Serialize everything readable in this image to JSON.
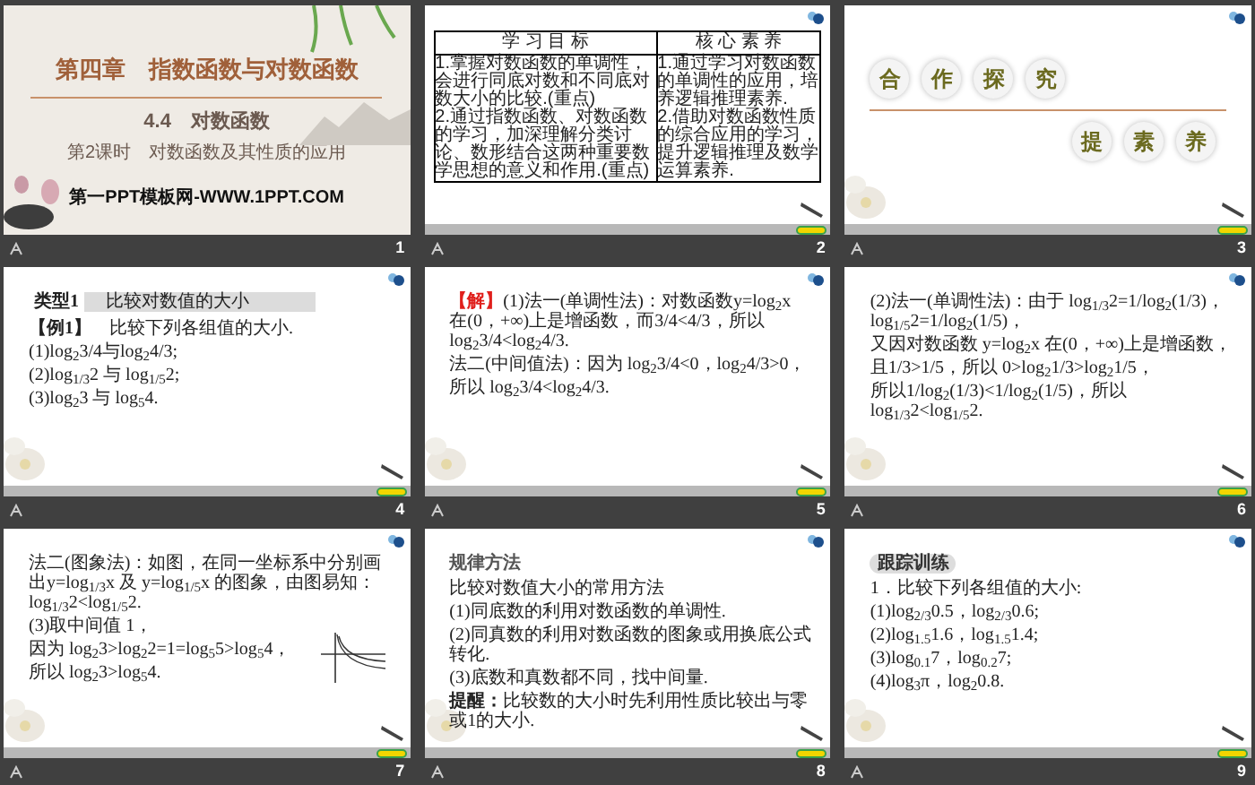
{
  "slides": [
    {
      "kind": "title",
      "number": "1",
      "chapter": "第四章　指数函数与对数函数",
      "section": "4.4　对数函数",
      "lesson": "第2课时　对数函数及其性质的应用",
      "site": "第一PPT模板网-WWW.1PPT.COM"
    },
    {
      "kind": "table",
      "number": "2",
      "columns": [
        "学 习 目 标",
        "核 心 素 养"
      ],
      "cells": [
        [
          "1.掌握对数函数的单调性，会进行同底对数和不同底对数大小的比较.(重点)",
          "2.通过指数函数、对数函数的学习，加深理解分类讨论、数形结合这两种重要数学思想的意义和作用.(重点)"
        ],
        [
          "1.通过学习对数函数的单调性的应用，培养逻辑推理素养.",
          "2.借助对数函数性质的综合应用的学习，提升逻辑推理及数学运算素养."
        ]
      ]
    },
    {
      "kind": "badges",
      "number": "3",
      "row_1": [
        "合",
        "作",
        "探",
        "究"
      ],
      "row_2": [
        "提",
        "素",
        "养"
      ]
    },
    {
      "kind": "lines",
      "number": "4",
      "tag": "类型1",
      "tag_title": "比较对数值的大小",
      "lines": [
        "**【例1】**　比较下列各组值的大小.",
        "(1)log$_{2}$3/4与log$_{2}$4/3;",
        "(2)log$_{1/3}$2 与 log$_{1/5}$2;",
        "(3)log$_{2}$3 与 log$_{5}$4."
      ]
    },
    {
      "kind": "lines",
      "number": "5",
      "lead": "【解】",
      "lines": [
        "(1)法一(单调性法)：对数函数y=log$_{2}$x 在(0，+∞)上是增函数，而3/4<4/3，所以 log$_{2}$3/4<log$_{2}$4/3.",
        "法二(中间值法)：因为 log$_{2}$3/4<0，log$_{2}$4/3>0，",
        "所以 log$_{2}$3/4<log$_{2}$4/3."
      ]
    },
    {
      "kind": "lines",
      "number": "6",
      "lines": [
        "(2)法一(单调性法)：由于 log$_{1/3}$2=1/log$_{2}$(1/3)，log$_{1/5}$2=1/log$_{2}$(1/5)，",
        "又因对数函数 y=log$_{2}$x 在(0，+∞)上是增函数，",
        "且1/3>1/5，所以 0>log$_{2}$1/3>log$_{2}$1/5，",
        "所以1/log$_{2}$(1/3)<1/log$_{2}$(1/5)，所以 log$_{1/3}$2<log$_{1/5}$2."
      ]
    },
    {
      "kind": "lines",
      "number": "7",
      "graph": true,
      "lines": [
        "法二(图象法)：如图，在同一坐标系中分别画出y=log$_{1/3}$x 及 y=log$_{1/5}$x 的图象，由图易知：log$_{1/3}$2<log$_{1/5}$2.",
        "(3)取中间值 1，",
        "因为 log$_{2}$3>log$_{2}$2=1=log$_{5}$5>log$_{5}$4，",
        "所以 log$_{2}$3>log$_{5}$4."
      ]
    },
    {
      "kind": "lines",
      "number": "8",
      "heading": "规律方法",
      "lines": [
        "比较对数值大小的常用方法",
        "(1)同底数的利用对数函数的单调性.",
        "(2)同真数的利用对数函数的图象或用换底公式转化.",
        "(3)底数和真数都不同，找中间量.",
        "**提醒：**比较数的大小时先利用性质比较出与零或1的大小."
      ]
    },
    {
      "kind": "lines",
      "number": "9",
      "badge_title": "跟踪训练",
      "lines": [
        "1．比较下列各组值的大小:",
        "(1)log$_{2/3}$0.5，log$_{2/3}$0.6;",
        "(2)log$_{1.5}$1.6，log$_{1.5}$1.4;",
        "(3)log$_{0.1}$7，log$_{0.2}$7;",
        "(4)log$_{3}$π，log$_{2}$0.8."
      ]
    }
  ]
}
